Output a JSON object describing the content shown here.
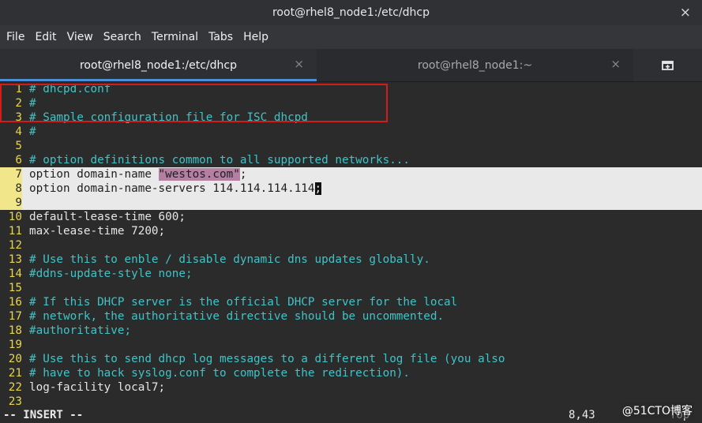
{
  "window": {
    "title": "root@rhel8_node1:/etc/dhcp",
    "close_symbol": "×"
  },
  "menu": [
    "File",
    "Edit",
    "View",
    "Search",
    "Terminal",
    "Tabs",
    "Help"
  ],
  "tabs": [
    {
      "label": "root@rhel8_node1:/etc/dhcp",
      "close": "×",
      "active": true
    },
    {
      "label": "root@rhel8_node1:~",
      "close": "×",
      "active": false
    }
  ],
  "editor": {
    "lines": [
      {
        "num": "1",
        "text": "# dhcpd.conf",
        "type": "comment"
      },
      {
        "num": "2",
        "text": "#",
        "type": "comment"
      },
      {
        "num": "3",
        "text": "# Sample configuration file for ISC dhcpd",
        "type": "comment"
      },
      {
        "num": "4",
        "text": "#",
        "type": "comment"
      },
      {
        "num": "5",
        "text": "",
        "type": "normal"
      },
      {
        "num": "6",
        "text": "# option definitions common to all supported networks...",
        "type": "comment"
      },
      {
        "num": "7",
        "pre": "option domain-name ",
        "str": "\"westos.com\"",
        "post": ";",
        "type": "hl"
      },
      {
        "num": "8",
        "pre": "option domain-name-servers 114.114.114.114",
        "cursor": ";",
        "type": "hl"
      },
      {
        "num": "9",
        "text": "",
        "type": "hl"
      },
      {
        "num": "10",
        "text": "default-lease-time 600;",
        "type": "normal"
      },
      {
        "num": "11",
        "text": "max-lease-time 7200;",
        "type": "normal"
      },
      {
        "num": "12",
        "text": "",
        "type": "normal"
      },
      {
        "num": "13",
        "text": "# Use this to enble / disable dynamic dns updates globally.",
        "type": "comment"
      },
      {
        "num": "14",
        "text": "#ddns-update-style none;",
        "type": "comment"
      },
      {
        "num": "15",
        "text": "",
        "type": "normal"
      },
      {
        "num": "16",
        "text": "# If this DHCP server is the official DHCP server for the local",
        "type": "comment"
      },
      {
        "num": "17",
        "text": "# network, the authoritative directive should be uncommented.",
        "type": "comment"
      },
      {
        "num": "18",
        "text": "#authoritative;",
        "type": "comment"
      },
      {
        "num": "19",
        "text": "",
        "type": "normal"
      },
      {
        "num": "20",
        "text": "# Use this to send dhcp log messages to a different log file (you also",
        "type": "comment"
      },
      {
        "num": "21",
        "text": "# have to hack syslog.conf to complete the redirection).",
        "type": "comment"
      },
      {
        "num": "22",
        "text": "log-facility local7;",
        "type": "normal"
      },
      {
        "num": "23",
        "text": "",
        "type": "normal"
      }
    ]
  },
  "status": {
    "mode": "-- INSERT --",
    "position": "8,43",
    "scroll": "Top"
  },
  "watermark": "@51CTO博客",
  "colors": {
    "comment": "#3ec4c8",
    "line_number": "#e8d54a",
    "highlight_box": "#d31c1c"
  }
}
